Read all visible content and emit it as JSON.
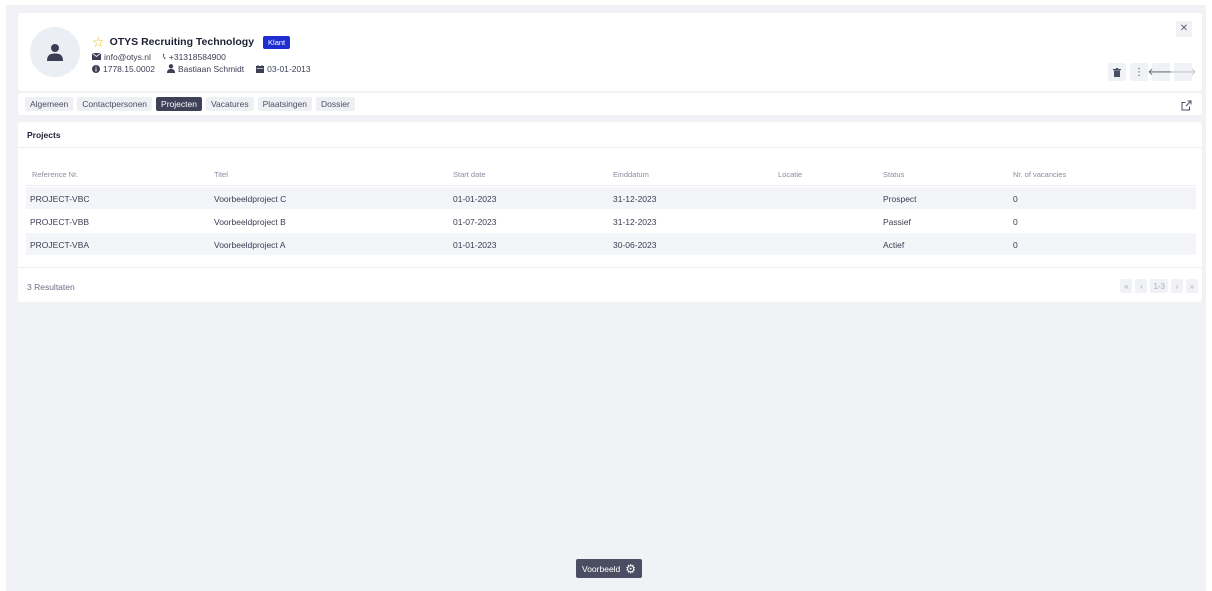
{
  "header": {
    "company": "OTYS Recruiting Technology",
    "badge": "Klant",
    "email": "info@otys.nl",
    "phone": "+31318584900",
    "reference": "1778.15.0002",
    "owner": "Bastiaan Schmidt",
    "date": "03-01-2013"
  },
  "tabs": [
    "Algemeen",
    "Contactpersonen",
    "Projecten",
    "Vacatures",
    "Plaatsingen",
    "Dossier"
  ],
  "active_tab": "Projecten",
  "projects": {
    "title": "Projects",
    "columns": [
      "Reference Nr.",
      "Titel",
      "Start date",
      "Einddatum",
      "Locatie",
      "Status",
      "Nr. of vacancies"
    ],
    "rows": [
      [
        "PROJECT-VBC",
        "Voorbeeldproject C",
        "01-01-2023",
        "31-12-2023",
        "",
        "Prospect",
        "0"
      ],
      [
        "PROJECT-VBB",
        "Voorbeeldproject B",
        "01-07-2023",
        "31-12-2023",
        "",
        "Passief",
        "0"
      ],
      [
        "PROJECT-VBA",
        "Voorbeeldproject A",
        "01-01-2023",
        "30-06-2023",
        "",
        "Actief",
        "0"
      ]
    ],
    "results": "3 Resultaten",
    "pagination": {
      "first": "«",
      "prev": "‹",
      "range": "1-3",
      "next": "›",
      "last": "»"
    }
  },
  "footer": {
    "button": "Voorbeeld"
  },
  "colors": {
    "accent_badge": "#1f2dd1",
    "active_tab": "#3f4159",
    "star": "#f2c00f",
    "background": "#f1f2f6"
  },
  "icons": {
    "avatar": "person-icon",
    "favorite": "star-icon",
    "email": "envelope-icon",
    "phone": "phone-icon",
    "reference": "info-circle-icon",
    "owner": "user-icon",
    "date": "calendar-icon",
    "close": "close-icon",
    "delete": "trash-icon",
    "more": "more-vertical-icon",
    "back": "arrow-left-icon",
    "forward": "arrow-right-icon",
    "external": "external-link-icon",
    "settings": "gear-icon"
  }
}
